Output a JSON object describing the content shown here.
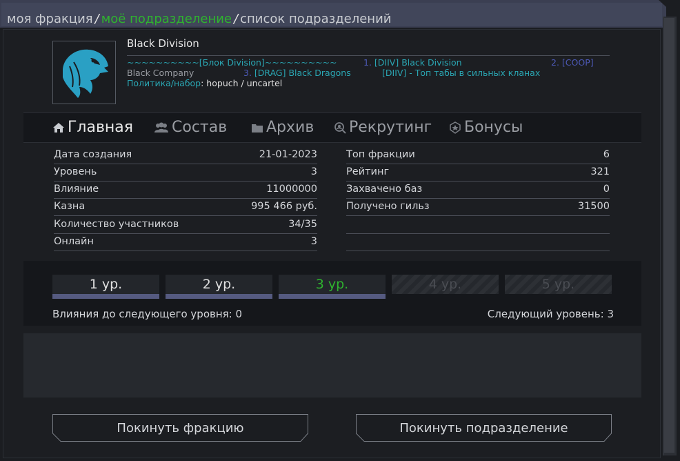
{
  "breadcrumb": {
    "item1": "моя фракция",
    "item2": "моё подразделение",
    "item3": "список подразделений",
    "sep": "/"
  },
  "clan": {
    "name": "Black Division",
    "bloc_prefix": "~~~~~~~~~~[",
    "bloc_name": "Блок Division",
    "bloc_suffix": "]~~~~~~~~~~",
    "alliance1_num": "1.",
    "alliance1": "[DIIV] Black Division",
    "alliance2_num": "2.",
    "alliance2": "[COOP]",
    "company": "Black Company",
    "alliance3_num": "3.",
    "alliance3": "[DRAG] Black Dragons",
    "slogan": "[DIIV] - Топ табы в сильных кланах",
    "policy_label": "Политика/набор",
    "policy_value": ": hopuch / uncartel"
  },
  "tabs": {
    "main": "Главная",
    "members": "Состав",
    "archive": "Архив",
    "recruiting": "Рекрутинг",
    "bonuses": "Бонусы"
  },
  "stats_left": [
    {
      "label": "Дата создания",
      "value": "21-01-2023"
    },
    {
      "label": "Уровень",
      "value": "3"
    },
    {
      "label": "Влияние",
      "value": "11000000"
    },
    {
      "label": "Казна",
      "value": "995 466 руб."
    },
    {
      "label": "Количество участников",
      "value": "34/35"
    },
    {
      "label": "Онлайн",
      "value": "3"
    }
  ],
  "stats_right": [
    {
      "label": "Топ фракции",
      "value": "6"
    },
    {
      "label": "Рейтинг",
      "value": "321"
    },
    {
      "label": "Захвачено баз",
      "value": "0"
    },
    {
      "label": "Получено гильз",
      "value": "31500"
    },
    {
      "label": "",
      "value": ""
    },
    {
      "label": "",
      "value": ""
    }
  ],
  "levels": [
    {
      "label": "1 ур.",
      "state": "done"
    },
    {
      "label": "2 ур.",
      "state": "done"
    },
    {
      "label": "3 ур.",
      "state": "current"
    },
    {
      "label": "4 ур.",
      "state": "locked"
    },
    {
      "label": "5 ур.",
      "state": "locked"
    }
  ],
  "progress": {
    "influence_to_next": "Влияния до следующего уровня: 0",
    "next_level": "Следующий уровень: 3"
  },
  "buttons": {
    "leave_faction": "Покинуть фракцию",
    "leave_division": "Покинуть подразделение"
  },
  "colors": {
    "accent_green": "#2fb32f",
    "accent_teal": "#2aa6b3",
    "accent_blue": "#4d5ab8",
    "logo_blue": "#2aa0c4"
  },
  "icons": {
    "main": "home-icon",
    "members": "users-icon",
    "archive": "folder-icon",
    "recruiting": "search-user-icon",
    "bonuses": "badge-icon",
    "logo": "eagle-logo"
  }
}
